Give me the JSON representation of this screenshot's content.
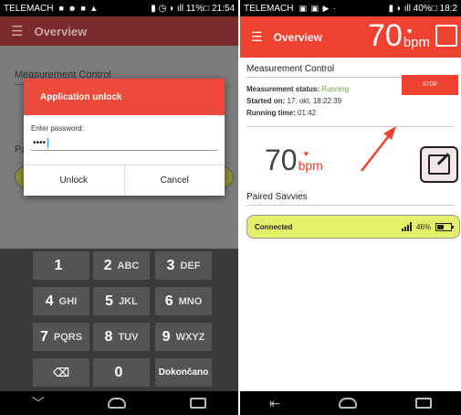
{
  "left": {
    "status": {
      "carrier": "TELEMACH",
      "icons": "■ ☻ ■ ▲",
      "right": "▮ ◷ ◗ ıll 11%□ 21:54"
    },
    "appbar": {
      "title": "Overview"
    },
    "background": {
      "section1": "Measurement Control",
      "section2": "Pa"
    },
    "dialog": {
      "title": "Application unlock",
      "label": "Enter password:",
      "value": "••••",
      "unlock": "Unlock",
      "cancel": "Cancel"
    },
    "keyboard": {
      "keys": [
        {
          "num": "1",
          "letters": ""
        },
        {
          "num": "2",
          "letters": "ABC"
        },
        {
          "num": "3",
          "letters": "DEF"
        },
        {
          "num": "4",
          "letters": "GHI"
        },
        {
          "num": "5",
          "letters": "JKL"
        },
        {
          "num": "6",
          "letters": "MNO"
        },
        {
          "num": "7",
          "letters": "PQRS"
        },
        {
          "num": "8",
          "letters": "TUV"
        },
        {
          "num": "9",
          "letters": "WXYZ"
        },
        {
          "num": "⌫",
          "letters": ""
        },
        {
          "num": "0",
          "letters": ""
        },
        {
          "num": "",
          "letters": "Dokončano"
        }
      ]
    },
    "nav": {
      "back": "﹀",
      "home": "",
      "recent": ""
    }
  },
  "right": {
    "status": {
      "carrier": "TELEMACH",
      "icons": "▣ ▣ ▶ ·",
      "right": "▮ ◗ ıll 40%□ 18:2"
    },
    "appbar": {
      "title": "Overview",
      "bpm": "70",
      "bpm_unit": "bpm"
    },
    "measurement": {
      "section_title": "Measurement Control",
      "status_label": "Measurement status:",
      "status_value": "Running",
      "started_label": "Started on:",
      "started_value": "17. okt. 18:22:39",
      "running_label": "Running time:",
      "running_value": "01:42",
      "stop": "STOP"
    },
    "heart_rate": {
      "value": "70",
      "unit": "bpm"
    },
    "paired": {
      "section_title": "Paired Savvies",
      "state": "Connected",
      "battery_pct": "46%",
      "battery_level": 0.46
    },
    "nav": {
      "back": "⇤",
      "home": "",
      "recent": ""
    }
  },
  "colors": {
    "accent": "#ef4231",
    "running": "#6ea53a",
    "connected_bg": "#e5f06a"
  }
}
